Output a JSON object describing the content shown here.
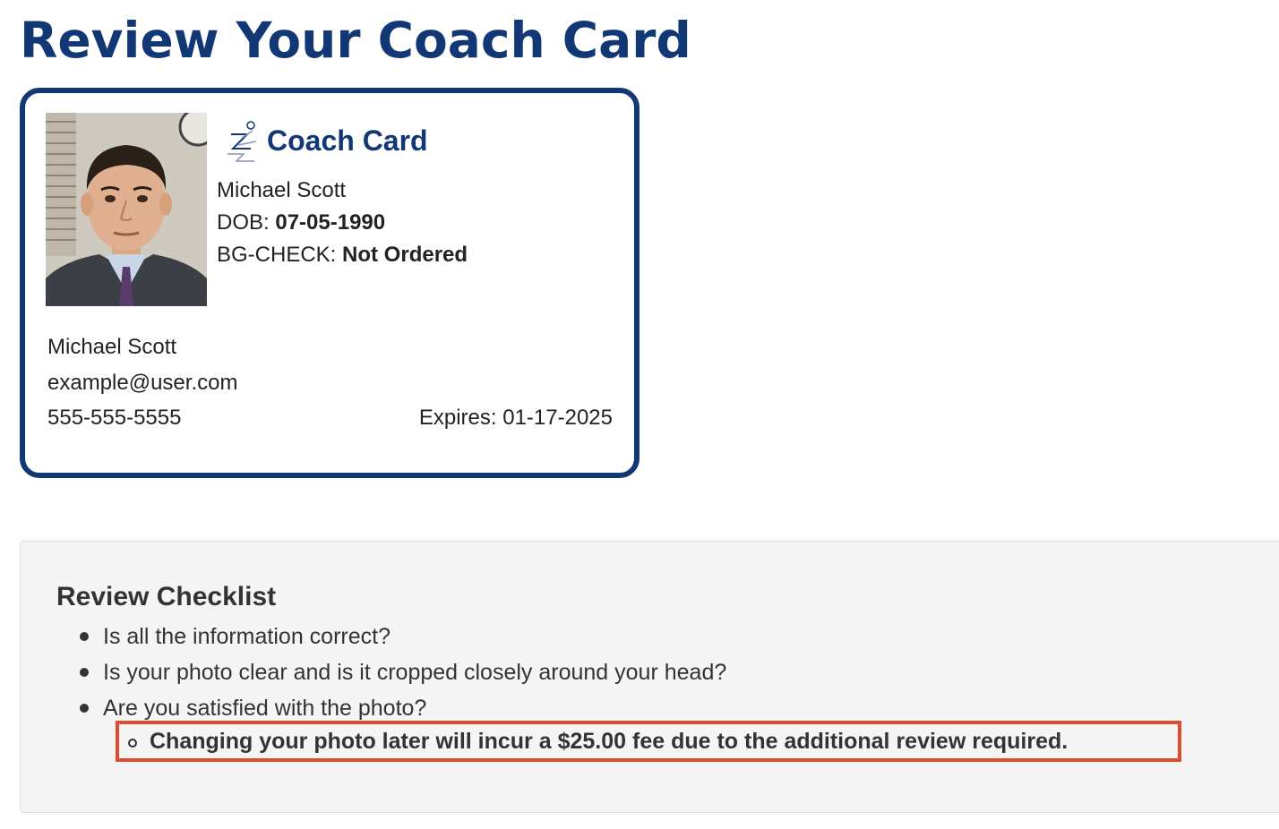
{
  "page": {
    "title": "Review Your Coach Card"
  },
  "card": {
    "title": "Coach Card",
    "name": "Michael Scott",
    "dob_label": "DOB:",
    "dob_value": "07-05-1990",
    "bg_label": "BG-CHECK:",
    "bg_value": "Not Ordered",
    "contact_name": "Michael Scott",
    "email": "example@user.com",
    "phone": "555-555-5555",
    "expires": "Expires: 01-17-2025",
    "logo_icon": "running-figure-icon",
    "photo_icon": "profile-photo"
  },
  "checklist": {
    "title": "Review Checklist",
    "items": [
      "Is all the information correct?",
      "Is your photo clear and is it cropped closely around your head?",
      "Are you satisfied with the photo?"
    ],
    "fee_note": "Changing your photo later will incur a $25.00 fee due to the additional review required."
  },
  "colors": {
    "brand": "#113875",
    "highlight_border": "#e04a2f",
    "panel_bg": "#f5f5f5"
  }
}
